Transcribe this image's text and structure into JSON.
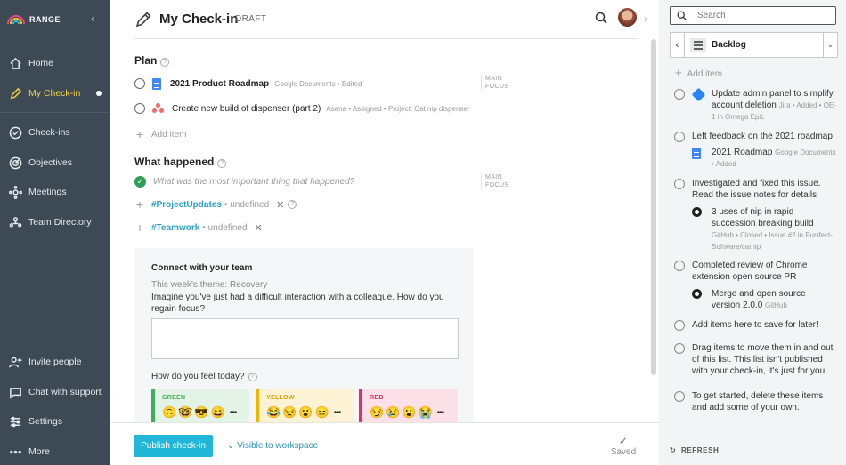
{
  "app": {
    "logo_text": "RANGE"
  },
  "sidebar": {
    "items": [
      {
        "label": "Home",
        "icon": "home-icon"
      },
      {
        "label": "My Check-in",
        "icon": "pencil-icon",
        "active": true
      },
      {
        "label": "Check-ins",
        "icon": "check-circle-icon"
      },
      {
        "label": "Objectives",
        "icon": "target-icon"
      },
      {
        "label": "Meetings",
        "icon": "meetings-icon"
      },
      {
        "label": "Team Directory",
        "icon": "team-icon"
      }
    ],
    "bottom": [
      {
        "label": "Invite people",
        "icon": "invite-icon"
      },
      {
        "label": "Chat with support",
        "icon": "chat-icon"
      },
      {
        "label": "Settings",
        "icon": "settings-icon"
      },
      {
        "label": "More",
        "icon": "more-icon"
      }
    ]
  },
  "header": {
    "title": "My Check-in",
    "status": "DRAFT"
  },
  "plan": {
    "title": "Plan",
    "focus_label_1": "MAIN",
    "focus_label_2": "FOCUS",
    "items": [
      {
        "title": "2021 Product Roadmap",
        "meta": "Google Documents • Edited",
        "icon": "google-doc-icon"
      },
      {
        "title": "Create new build of dispenser (part 2)",
        "meta": "Asana • Assigned • Project: Cat nip dispenser",
        "icon": "asana-icon"
      }
    ],
    "add_item": "Add item"
  },
  "what_happened": {
    "title": "What happened",
    "placeholder": "What was the most important thing that happened?",
    "focus_label_1": "MAIN",
    "focus_label_2": "FOCUS",
    "tags": [
      {
        "tag": "#ProjectUpdates",
        "value": "• undefined"
      },
      {
        "tag": "#Teamwork",
        "value": "• undefined"
      }
    ]
  },
  "connect": {
    "title": "Connect with your team",
    "theme": "This week's theme: Recovery",
    "question": "Imagine you've just had a difficult interaction with a colleague. How do you regain focus?",
    "feel_label": "How do you feel today?",
    "moods": [
      {
        "label": "GREEN",
        "color": "#3fae5a",
        "bg": "#e3f3e6",
        "faces": [
          "🙃",
          "🤓",
          "😎",
          "😄"
        ]
      },
      {
        "label": "YELLOW",
        "color": "#f0b400",
        "bg": "#fdf3d4",
        "faces": [
          "😂",
          "😒",
          "😮",
          "😑"
        ]
      },
      {
        "label": "RED",
        "color": "#e62e6b",
        "bg": "#fbe0e8",
        "faces": [
          "😏",
          "😢",
          "😮",
          "😭"
        ]
      }
    ],
    "more": "•••"
  },
  "footer": {
    "publish": "Publish check-in",
    "visibility": "Visible to workspace",
    "saved": "Saved"
  },
  "right": {
    "search_placeholder": "Search",
    "list_name": "Backlog",
    "add_item": "Add item",
    "items": [
      {
        "text": "Update admin panel to simplify account deletion",
        "meta": "Jira • Added • OE-1 in Omega Epic"
      },
      {
        "text": "Left feedback on the 2021 roadmap",
        "sub_title": "2021 Roadmap",
        "sub_meta": "Google Documents • Added"
      },
      {
        "text": "Investigated and fixed this issue. Read the issue notes for details.",
        "sub_title": "3 uses of nip in rapid succession breaking build",
        "sub_meta": "GitHub • Closed • Issue #2 in Purrfect-Software/catnip"
      },
      {
        "text": "Completed review of Chrome extension open source PR",
        "sub_title": "Merge and open source version 2.0.0",
        "sub_meta": "GitHub"
      },
      {
        "text": "Add items here to save for later!"
      },
      {
        "text": "Drag items to move them in and out of this list. This list isn't published with your check-in, it's just for you."
      },
      {
        "text": "To get started, delete these items and add some of your own."
      }
    ],
    "refresh": "REFRESH"
  }
}
